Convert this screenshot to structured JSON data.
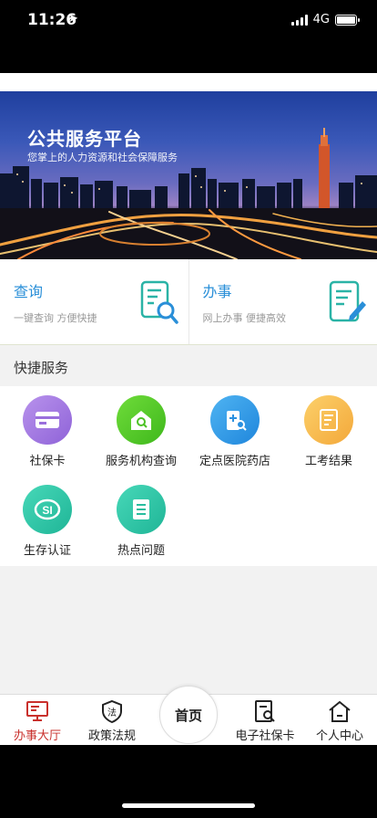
{
  "status_bar": {
    "time": "11:26",
    "network": "4G"
  },
  "banner": {
    "title": "公共服务平台",
    "subtitle": "您掌上的人力资源和社会保障服务"
  },
  "cards": [
    {
      "title": "查询",
      "desc": "一键查询 方便快捷",
      "icon": "document-search-icon"
    },
    {
      "title": "办事",
      "desc": "网上办事 便捷高效",
      "icon": "document-edit-icon"
    }
  ],
  "quick_services": {
    "title": "快捷服务",
    "items": [
      {
        "label": "社保卡",
        "icon": "card-icon",
        "color": "#a77ee0"
      },
      {
        "label": "服务机构查询",
        "icon": "home-search-icon",
        "color": "#52c41a"
      },
      {
        "label": "定点医院药店",
        "icon": "hospital-search-icon",
        "color": "#2f9be8"
      },
      {
        "label": "工考结果",
        "icon": "exam-result-icon",
        "color": "#f5b642"
      },
      {
        "label": "生存认证",
        "icon": "si-logo-icon",
        "color": "#2fc8a8"
      },
      {
        "label": "热点问题",
        "icon": "list-icon",
        "color": "#2fc8a8"
      }
    ]
  },
  "tabbar": {
    "items": [
      {
        "label": "办事大厅",
        "icon": "monitor-icon",
        "active": true
      },
      {
        "label": "政策法规",
        "icon": "law-shield-icon",
        "active": false
      },
      {
        "label": "电子社保卡",
        "icon": "doc-search-icon",
        "active": false
      },
      {
        "label": "个人中心",
        "icon": "house-outline-icon",
        "active": false
      }
    ],
    "home_label": "首页"
  },
  "colors": {
    "accent": "#2a8fd8",
    "active_tab": "#c9302c"
  }
}
